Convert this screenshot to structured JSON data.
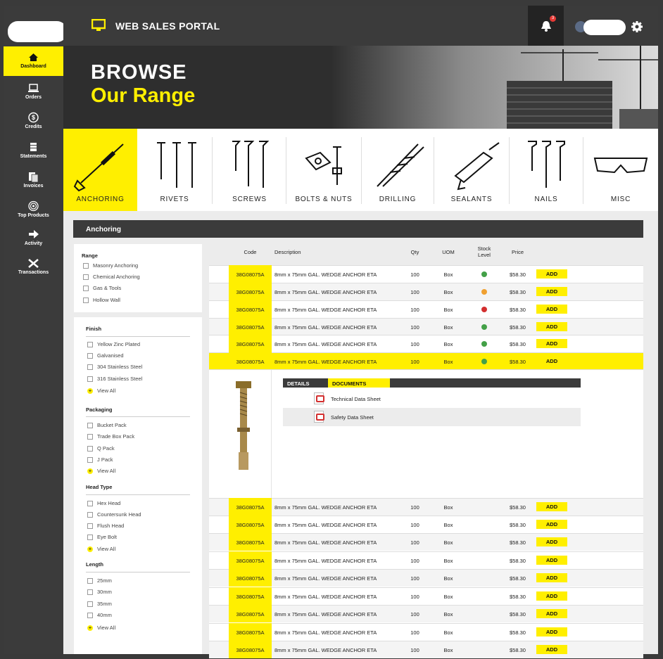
{
  "header": {
    "title": "WEB SALES PORTAL",
    "notification_count": "3"
  },
  "sidebar": {
    "items": [
      {
        "label": "Dashboard",
        "icon": "home-icon"
      },
      {
        "label": "Orders",
        "icon": "laptop-icon"
      },
      {
        "label": "Credits",
        "icon": "dollar-icon"
      },
      {
        "label": "Statements",
        "icon": "stack-icon"
      },
      {
        "label": "Invoices",
        "icon": "documents-icon"
      },
      {
        "label": "Top Products",
        "icon": "target-icon"
      },
      {
        "label": "Activity",
        "icon": "arrow-right-icon"
      },
      {
        "label": "Transactions",
        "icon": "tools-icon"
      }
    ]
  },
  "hero": {
    "line1": "BROWSE",
    "line2": "Our Range"
  },
  "categories": [
    "ANCHORING",
    "RIVETS",
    "SCREWS",
    "BOLTS & NUTS",
    "DRILLING",
    "SEALANTS",
    "NAILS",
    "MISC"
  ],
  "section_title": "Anchoring",
  "filters": {
    "range": {
      "title": "Range",
      "options": [
        "Masonry Anchoring",
        "Chemical Anchoring",
        "Gas & Tools",
        "Hollow Wall"
      ]
    },
    "finish": {
      "title": "Finish",
      "options": [
        "Yellow Zinc Plated",
        "Galvanised",
        "304 Stainless Steel",
        "316 Stainless Steel"
      ],
      "view_all": "View All"
    },
    "packaging": {
      "title": "Packaging",
      "options": [
        "Bucket Pack",
        "Trade Box Pack",
        "Q Pack",
        "J Pack"
      ],
      "view_all": "View All"
    },
    "head_type": {
      "title": "Head Type",
      "options": [
        "Hex Head",
        "Countersunk Head",
        "Flush Head",
        "Eye Bolt"
      ],
      "view_all": "View All"
    },
    "length": {
      "title": "Length",
      "options": [
        "25mm",
        "30mm",
        "35mm",
        "40mm"
      ],
      "view_all": "View All"
    }
  },
  "table": {
    "headers": {
      "code": "Code",
      "description": "Description",
      "qty": "Qty",
      "uom": "UOM",
      "stock_line1": "Stock",
      "stock_line2": "Level",
      "price": "Price"
    },
    "add_label": "ADD",
    "rows_top": [
      {
        "code": "38G08075A",
        "description": "8mm x 75mm GAL. WEDGE ANCHOR ETA",
        "qty": "100",
        "uom": "Box",
        "stock": "#43a047",
        "price": "$58.30"
      },
      {
        "code": "38G08075A",
        "description": "8mm x 75mm GAL. WEDGE ANCHOR ETA",
        "qty": "100",
        "uom": "Box",
        "stock": "#f0a030",
        "price": "$58.30"
      },
      {
        "code": "38G08075A",
        "description": "8mm x 75mm GAL. WEDGE ANCHOR ETA",
        "qty": "100",
        "uom": "Box",
        "stock": "#d32f2f",
        "price": "$58.30"
      },
      {
        "code": "38G08075A",
        "description": "8mm x 75mm GAL. WEDGE ANCHOR ETA",
        "qty": "100",
        "uom": "Box",
        "stock": "#43a047",
        "price": "$58.30"
      },
      {
        "code": "38G08075A",
        "description": "8mm x 75mm GAL. WEDGE ANCHOR ETA",
        "qty": "100",
        "uom": "Box",
        "stock": "#43a047",
        "price": "$58.30"
      },
      {
        "code": "38G08075A",
        "description": "8mm x 75mm GAL. WEDGE ANCHOR ETA",
        "qty": "100",
        "uom": "Box",
        "stock": "#43a047",
        "price": "$58.30"
      }
    ],
    "detail": {
      "tabs": [
        "DETAILS",
        "DOCUMENTS"
      ],
      "documents": [
        "Technical Data Sheet",
        "Safety Data Sheet"
      ]
    },
    "rows_bottom": [
      {
        "code": "38G08075A",
        "description": "8mm x 75mm GAL. WEDGE ANCHOR ETA",
        "qty": "100",
        "uom": "Box",
        "price": "$58.30"
      },
      {
        "code": "38G08075A",
        "description": "8mm x 75mm GAL. WEDGE ANCHOR ETA",
        "qty": "100",
        "uom": "Box",
        "price": "$58.30"
      },
      {
        "code": "38G08075A",
        "description": "8mm x 75mm GAL. WEDGE ANCHOR ETA",
        "qty": "100",
        "uom": "Box",
        "price": "$58.30"
      },
      {
        "code": "38G08075A",
        "description": "8mm x 75mm GAL. WEDGE ANCHOR ETA",
        "qty": "100",
        "uom": "Box",
        "price": "$58.30"
      },
      {
        "code": "38G08075A",
        "description": "8mm x 75mm GAL. WEDGE ANCHOR ETA",
        "qty": "100",
        "uom": "Box",
        "price": "$58.30"
      },
      {
        "code": "38G08075A",
        "description": "8mm x 75mm GAL. WEDGE ANCHOR ETA",
        "qty": "100",
        "uom": "Box",
        "price": "$58.30"
      },
      {
        "code": "38G08075A",
        "description": "8mm x 75mm GAL. WEDGE ANCHOR ETA",
        "qty": "100",
        "uom": "Box",
        "price": "$58.30"
      },
      {
        "code": "38G08075A",
        "description": "8mm x 75mm GAL. WEDGE ANCHOR ETA",
        "qty": "100",
        "uom": "Box",
        "price": "$58.30"
      },
      {
        "code": "38G08075A",
        "description": "8mm x 75mm GAL. WEDGE ANCHOR ETA",
        "qty": "100",
        "uom": "Box",
        "price": "$58.30"
      }
    ]
  },
  "colors": {
    "accent": "#ffef00",
    "dark": "#3b3b3b"
  }
}
